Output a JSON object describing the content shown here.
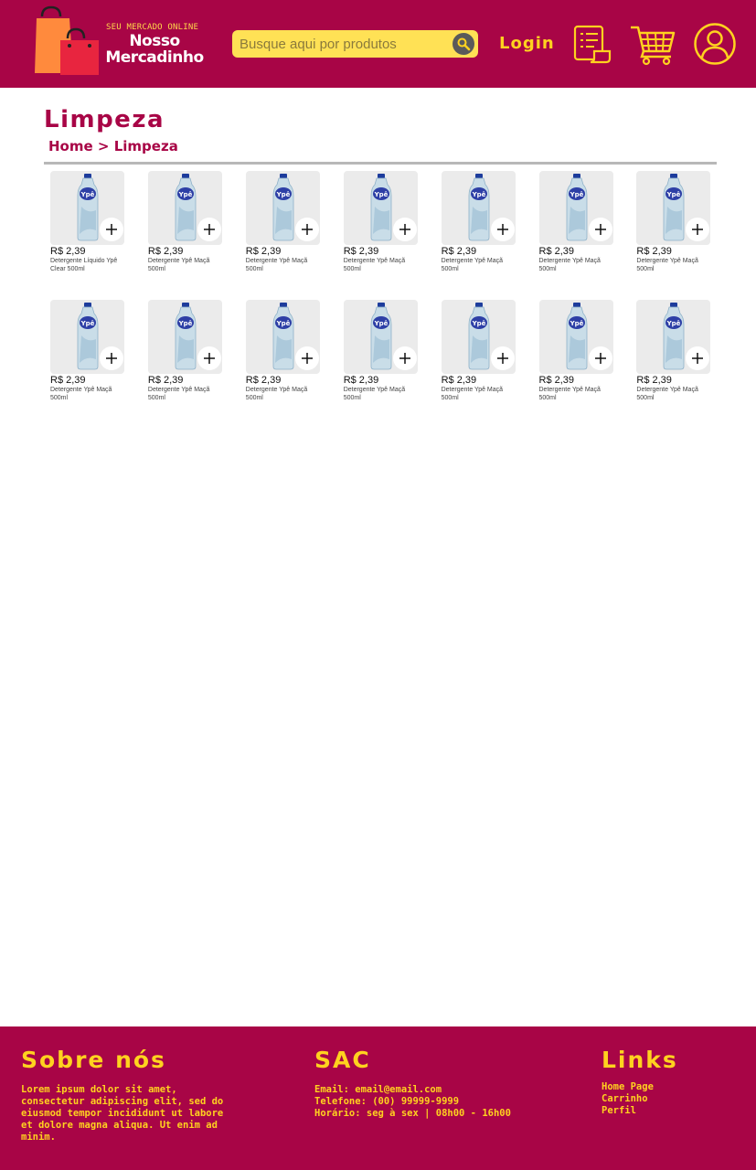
{
  "header": {
    "logo_tagline": "SEU MERCADO ONLINE",
    "logo_name_line1": "Nosso",
    "logo_name_line2": "Mercadinho",
    "search_placeholder": "Busque aqui por produtos",
    "login_label": "Login",
    "icons": [
      "search-icon",
      "orders-icon",
      "cart-icon",
      "profile-icon"
    ]
  },
  "page": {
    "title": "Limpeza",
    "breadcrumb": [
      "Home",
      ">",
      "Limpeza"
    ]
  },
  "products": [
    {
      "price": "R$ 2,39",
      "name": "Detergente Líquido Ypê Clear 500ml"
    },
    {
      "price": "R$ 2,39",
      "name": "Detergente Ypê Maçã 500ml"
    },
    {
      "price": "R$ 2,39",
      "name": "Detergente Ypê Maçã 500ml"
    },
    {
      "price": "R$ 2,39",
      "name": "Detergente Ypê Maçã 500ml"
    },
    {
      "price": "R$ 2,39",
      "name": "Detergente Ypê Maçã 500ml"
    },
    {
      "price": "R$ 2,39",
      "name": "Detergente Ypê Maçã 500ml"
    },
    {
      "price": "R$ 2,39",
      "name": "Detergente Ypê Maçã 500ml"
    },
    {
      "price": "R$ 2,39",
      "name": "Detergente Ypê Maçã 500ml"
    },
    {
      "price": "R$ 2,39",
      "name": "Detergente Ypê Maçã 500ml"
    },
    {
      "price": "R$ 2,39",
      "name": "Detergente Ypê Maçã 500ml"
    },
    {
      "price": "R$ 2,39",
      "name": "Detergente Ypê Maçã 500ml"
    },
    {
      "price": "R$ 2,39",
      "name": "Detergente Ypê Maçã 500ml"
    },
    {
      "price": "R$ 2,39",
      "name": "Detergente Ypê Maçã 500ml"
    },
    {
      "price": "R$ 2,39",
      "name": "Detergente Ypê Maçã 500ml"
    }
  ],
  "footer": {
    "about_title": "Sobre nós",
    "about_text": "Lorem ipsum dolor sit amet, consectetur adipiscing elit, sed do eiusmod tempor incididunt ut labore et dolore magna aliqua. Ut enim ad minim.",
    "sac_title": "SAC",
    "sac_email": "Email: email@email.com",
    "sac_phone": "Telefone: (00) 99999-9999",
    "sac_hours": "Horário: seg à sex | 08h00 - 16h00",
    "links_title": "Links",
    "links": [
      "Home Page",
      "Carrinho",
      "Perfil"
    ]
  },
  "colors": {
    "brand": "#a80546",
    "accent": "#ffd21f",
    "search_bg": "#ffe155"
  }
}
